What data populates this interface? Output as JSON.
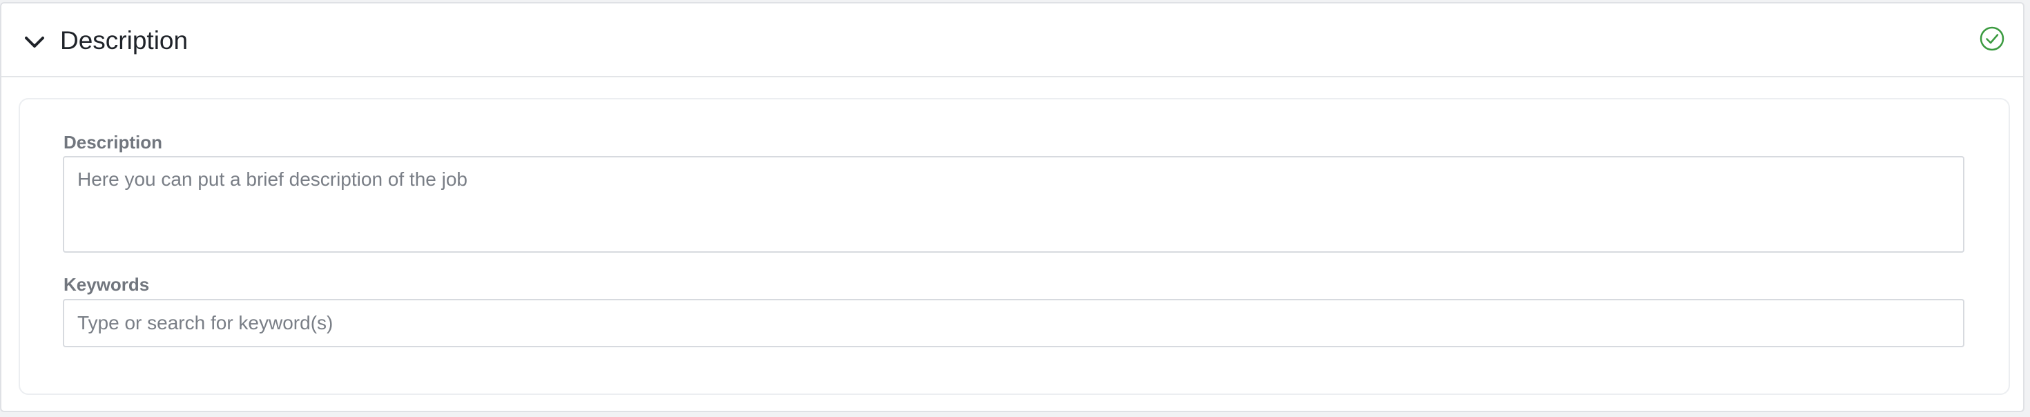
{
  "section": {
    "title": "Description",
    "toggle_icon": "chevron-down-icon",
    "status_icon": "check-circle-icon",
    "status_color": "#3a9a3f"
  },
  "fields": {
    "description": {
      "label": "Description",
      "value": "",
      "placeholder": "Here you can put a brief description of the job"
    },
    "keywords": {
      "label": "Keywords",
      "value": "",
      "placeholder": "Type or search for keyword(s)"
    }
  }
}
